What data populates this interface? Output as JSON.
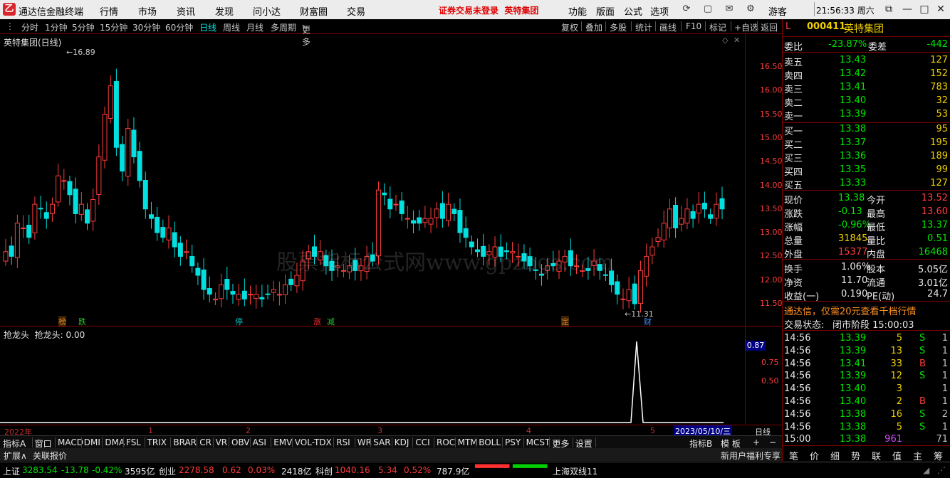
{
  "app": {
    "title": "通达信金融终端"
  },
  "menu": [
    "行情",
    "市场",
    "资讯",
    "发现",
    "问小达",
    "财富圈",
    "交易"
  ],
  "notice": "证券交易未登录",
  "notice_stock": "英特集团",
  "right_menu": [
    "功能",
    "版面",
    "公式",
    "选项"
  ],
  "user": "游客",
  "clock": "21:56:33 周六",
  "periods": [
    "分时",
    "1分钟",
    "5分钟",
    "15分钟",
    "30分钟",
    "60分钟",
    "日线",
    "周线",
    "月线",
    "多周期",
    "更多"
  ],
  "active_period": "日线",
  "tools": [
    "复权",
    "叠加",
    "多股",
    "统计",
    "画线",
    "F10",
    "标记",
    "+自选",
    "返回"
  ],
  "chart": {
    "title": "英特集团(日线)",
    "high_label": "16.89",
    "low_label": "11.31",
    "price_ticks": [
      "16.50",
      "16.00",
      "15.50",
      "15.00",
      "14.50",
      "14.00",
      "13.50",
      "13.00",
      "12.50",
      "12.00",
      "11.50"
    ],
    "watermark": "股票指标公式网www.gpzbgs.com",
    "event_markers": [
      {
        "text": "榜",
        "color": "#d08030"
      },
      {
        "text": "跌",
        "color": "#30c030"
      },
      {
        "text": "停",
        "color": "#00c0c0"
      },
      {
        "text": "涨",
        "color": "#ff3030"
      },
      {
        "text": "减",
        "color": "#30c030"
      },
      {
        "text": "定",
        "color": "#d08030"
      },
      {
        "text": "财",
        "color": "#4090ff"
      }
    ]
  },
  "chart_data": {
    "type": "candlestick",
    "title": "英特集团(日线)",
    "ylim": [
      11.3,
      16.9
    ],
    "note_count": 95
  },
  "indicator": {
    "title": "抢龙头",
    "value_label": "抢龙头: 0.00",
    "current": "0.87",
    "ticks": [
      "0.75",
      "0.50"
    ]
  },
  "time_axis": {
    "labels": [
      "2022年",
      "1",
      "2",
      "3",
      "4",
      "5"
    ],
    "cursor_date": "2023/05/10/三",
    "period": "日线"
  },
  "indicator_tabs": [
    "指标A",
    "窗口",
    "MACD",
    "DMI",
    "DMA",
    "FSL",
    "TRIX",
    "BRAR",
    "CR",
    "VR",
    "OBV",
    "ASI",
    "EMV",
    "VOL-TDX",
    "RSI",
    "WR",
    "SAR",
    "KDJ",
    "CCI",
    "ROC",
    "MTM",
    "BOLL",
    "PSY",
    "MCST",
    "更多",
    "设置"
  ],
  "indicator_tabs_right": [
    "指标B",
    "模 板",
    "+",
    "−"
  ],
  "ext_bar": [
    "扩展∧",
    "关联报价"
  ],
  "ext_bar_right": "新用户福利专享",
  "quote": {
    "code": "000411",
    "name": "英特集团",
    "market_tag": "L",
    "weibi_label": "委比",
    "weibi": "-23.87%",
    "weicha_label": "委差",
    "weicha": "-442",
    "asks": [
      {
        "label": "卖五",
        "price": "13.43",
        "vol": "127"
      },
      {
        "label": "卖四",
        "price": "13.42",
        "vol": "152"
      },
      {
        "label": "卖三",
        "price": "13.41",
        "vol": "783"
      },
      {
        "label": "卖二",
        "price": "13.40",
        "vol": "32"
      },
      {
        "label": "卖一",
        "price": "13.39",
        "vol": "53"
      }
    ],
    "bids": [
      {
        "label": "买一",
        "price": "13.38",
        "vol": "95"
      },
      {
        "label": "买二",
        "price": "13.37",
        "vol": "195"
      },
      {
        "label": "买三",
        "price": "13.36",
        "vol": "189"
      },
      {
        "label": "买四",
        "price": "13.35",
        "vol": "99"
      },
      {
        "label": "买五",
        "price": "13.33",
        "vol": "127"
      }
    ],
    "stats": [
      {
        "l1": "现价",
        "v1": "13.38",
        "c1": "green",
        "l2": "今开",
        "v2": "13.52",
        "c2": "red"
      },
      {
        "l1": "涨跌",
        "v1": "-0.13",
        "c1": "green",
        "l2": "最高",
        "v2": "13.60",
        "c2": "red"
      },
      {
        "l1": "涨幅",
        "v1": "-0.96%",
        "c1": "green",
        "l2": "最低",
        "v2": "13.37",
        "c2": "green"
      },
      {
        "l1": "总量",
        "v1": "31845",
        "c1": "yellow",
        "l2": "量比",
        "v2": "0.51",
        "c2": "green"
      },
      {
        "l1": "外盘",
        "v1": "15377",
        "c1": "red",
        "l2": "内盘",
        "v2": "16468",
        "c2": "green"
      }
    ],
    "fund": [
      {
        "l1": "换手",
        "v1": "1.06%",
        "l2": "股本",
        "v2": "5.05亿"
      },
      {
        "l1": "净资",
        "v1": "11.70",
        "l2": "流通",
        "v2": "3.01亿"
      },
      {
        "l1": "收益(一)",
        "v1": "0.190",
        "l2": "PE(动)",
        "v2": "24.7"
      }
    ],
    "ad": "通达信，仅需20元查看千档行情",
    "trade_status_label": "交易状态:",
    "trade_status": "闭市阶段 15:00:03",
    "ticks": [
      {
        "time": "14:56",
        "price": "13.39",
        "vol": "5",
        "bs": "S"
      },
      {
        "time": "14:56",
        "price": "13.39",
        "vol": "13",
        "bs": "S"
      },
      {
        "time": "14:56",
        "price": "13.41",
        "vol": "33",
        "bs": "B"
      },
      {
        "time": "14:56",
        "price": "13.39",
        "vol": "12",
        "bs": "S"
      },
      {
        "time": "14:56",
        "price": "13.40",
        "vol": "3",
        "bs": ""
      },
      {
        "time": "14:56",
        "price": "13.40",
        "vol": "2",
        "bs": "B"
      },
      {
        "time": "14:56",
        "price": "13.38",
        "vol": "16",
        "bs": "S"
      },
      {
        "time": "14:56",
        "price": "13.38",
        "vol": "5",
        "bs": "S"
      },
      {
        "time": "15:00",
        "price": "13.38",
        "vol": "961",
        "bs": ""
      }
    ],
    "tick_counts": [
      "1",
      "1",
      "1",
      "1",
      "1",
      "1",
      "2",
      "1",
      "71"
    ],
    "bottom_tabs": [
      "笔",
      "价",
      "细",
      "势",
      "联",
      "值",
      "主",
      "筹"
    ]
  },
  "status": {
    "sh_label": "上证",
    "sh_val": "3283.54",
    "sh_chg": "-13.78",
    "sh_pct": "-0.42%",
    "sh_amt": "3595亿",
    "cy_label": "创业",
    "cy_val": "2278.58",
    "cy_chg": "0.62",
    "cy_pct": "0.03%",
    "cy_amt": "2418亿",
    "kc_label": "科创",
    "kc_val": "1040.16",
    "kc_chg": "5.34",
    "kc_pct": "0.52%",
    "kc_amt": "787.9亿",
    "line": "上海双线11"
  },
  "colors": {
    "up": "#ff3c3c",
    "down": "#00e0e0",
    "border": "#800000"
  }
}
